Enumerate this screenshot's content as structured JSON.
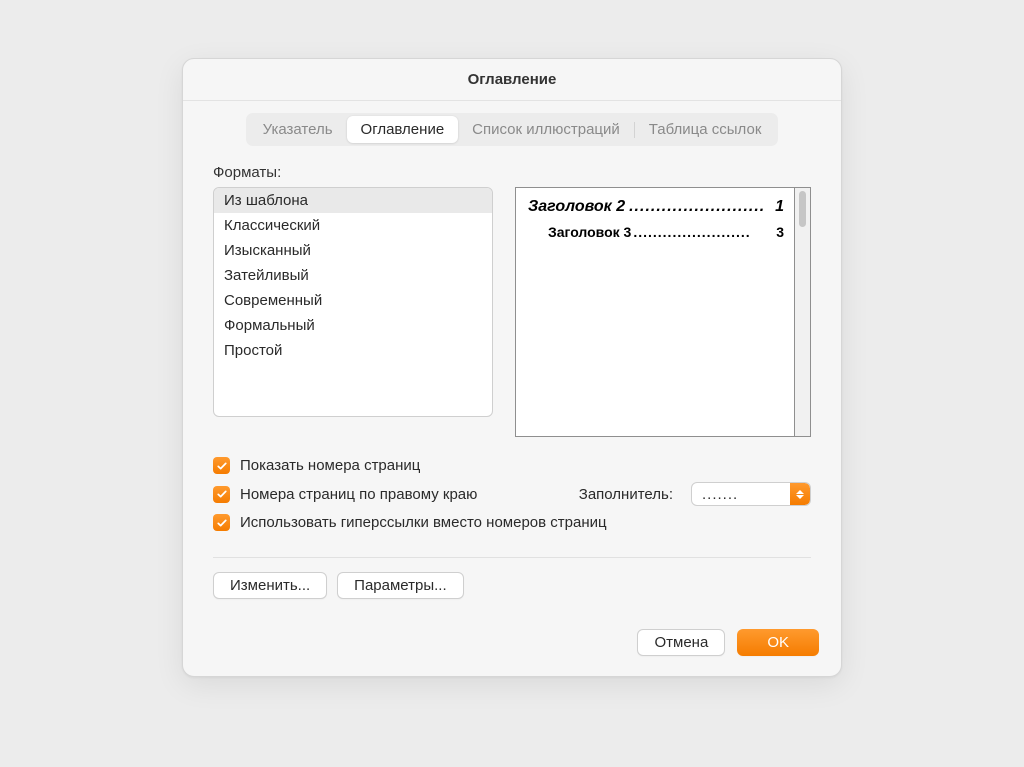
{
  "title": "Оглавление",
  "tabs": [
    {
      "label": "Указатель",
      "active": false
    },
    {
      "label": "Оглавление",
      "active": true
    },
    {
      "label": "Список иллюстраций",
      "active": false
    },
    {
      "label": "Таблица ссылок",
      "active": false
    }
  ],
  "formats_label": "Форматы:",
  "formats": [
    {
      "label": "Из шаблона",
      "selected": true
    },
    {
      "label": "Классический",
      "selected": false
    },
    {
      "label": "Изысканный",
      "selected": false
    },
    {
      "label": "Затейливый",
      "selected": false
    },
    {
      "label": "Современный",
      "selected": false
    },
    {
      "label": "Формальный",
      "selected": false
    },
    {
      "label": "Простой",
      "selected": false
    }
  ],
  "preview": {
    "line1_text": "Заголовок 2",
    "line1_dots": ".........................",
    "line1_page": "1",
    "line2_text": "Заголовок 3",
    "line2_dots": "........................",
    "line2_page": "3"
  },
  "checkboxes": {
    "show_page_numbers": "Показать номера страниц",
    "right_align": "Номера страниц по правому краю",
    "use_hyperlinks": "Использовать гиперссылки вместо номеров страниц"
  },
  "filler_label": "Заполнитель:",
  "filler_value": ".......",
  "buttons": {
    "modify": "Изменить...",
    "options": "Параметры...",
    "cancel": "Отмена",
    "ok": "OK"
  }
}
